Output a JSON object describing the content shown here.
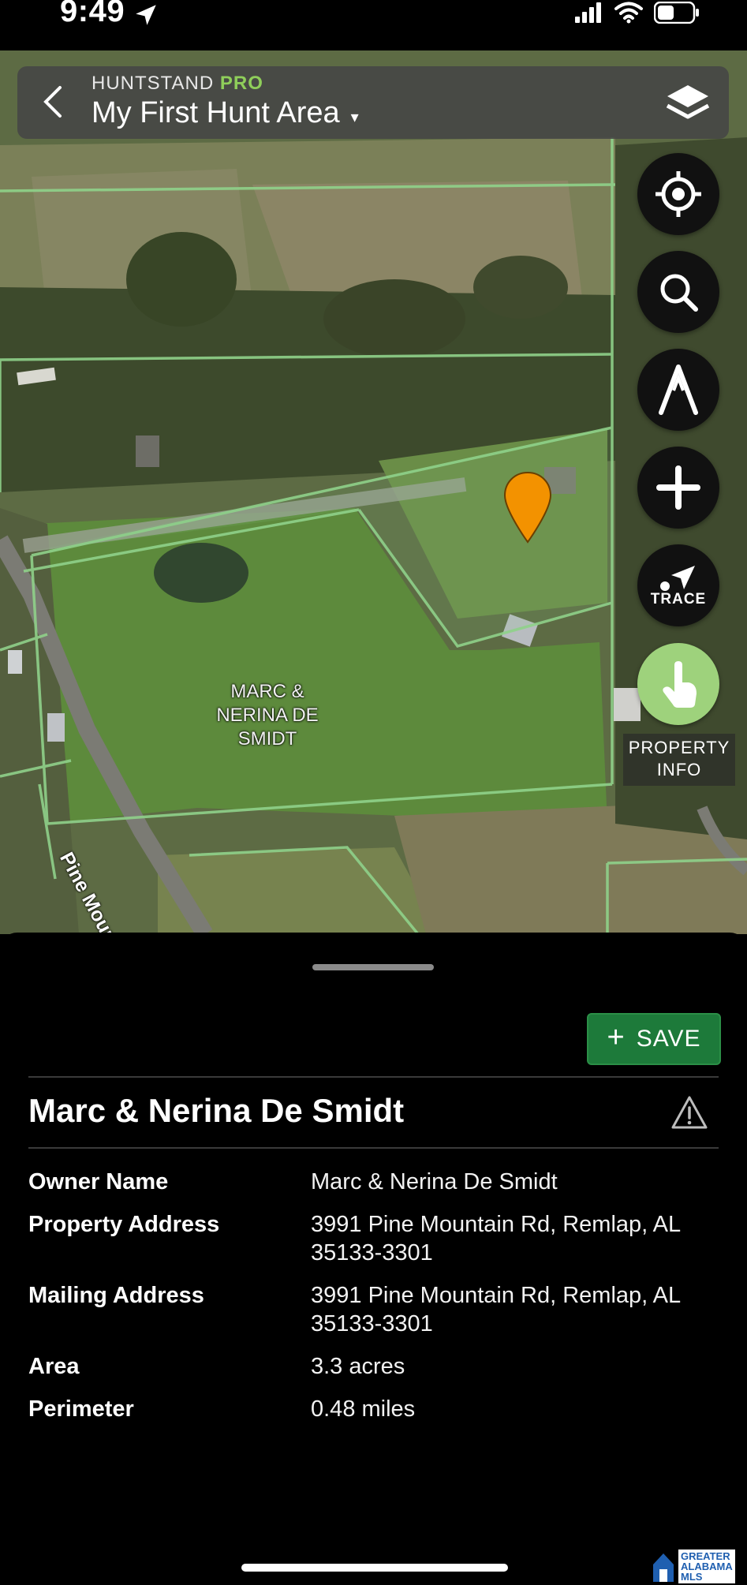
{
  "status_bar": {
    "time": "9:49"
  },
  "header": {
    "brand": "HUNTSTAND",
    "brand_tier": "PRO",
    "title": "My First Hunt Area",
    "caret": "▾"
  },
  "map": {
    "parcel_label": "MARC & NERINA DE SMIDT",
    "road_label": "Pine Mountain Rd",
    "marker_color": "#f39200",
    "parcel_line_color": "#8fd18a"
  },
  "fabs": {
    "trace_label": "TRACE",
    "property_info_label": "PROPERTY INFO"
  },
  "sheet": {
    "save_label": "SAVE",
    "owner_title": "Marc & Nerina De Smidt",
    "rows": [
      {
        "label": "Owner Name",
        "value": "Marc & Nerina De Smidt"
      },
      {
        "label": "Property Address",
        "value": "3991 Pine Mountain Rd, Remlap, AL 35133-3301"
      },
      {
        "label": "Mailing Address",
        "value": "3991 Pine Mountain Rd, Remlap, AL 35133-3301"
      },
      {
        "label": "Area",
        "value": "3.3 acres"
      },
      {
        "label": "Perimeter",
        "value": "0.48 miles"
      }
    ]
  },
  "watermark": {
    "line1": "GREATER",
    "line2": "ALABAMA",
    "line3": "MLS"
  }
}
